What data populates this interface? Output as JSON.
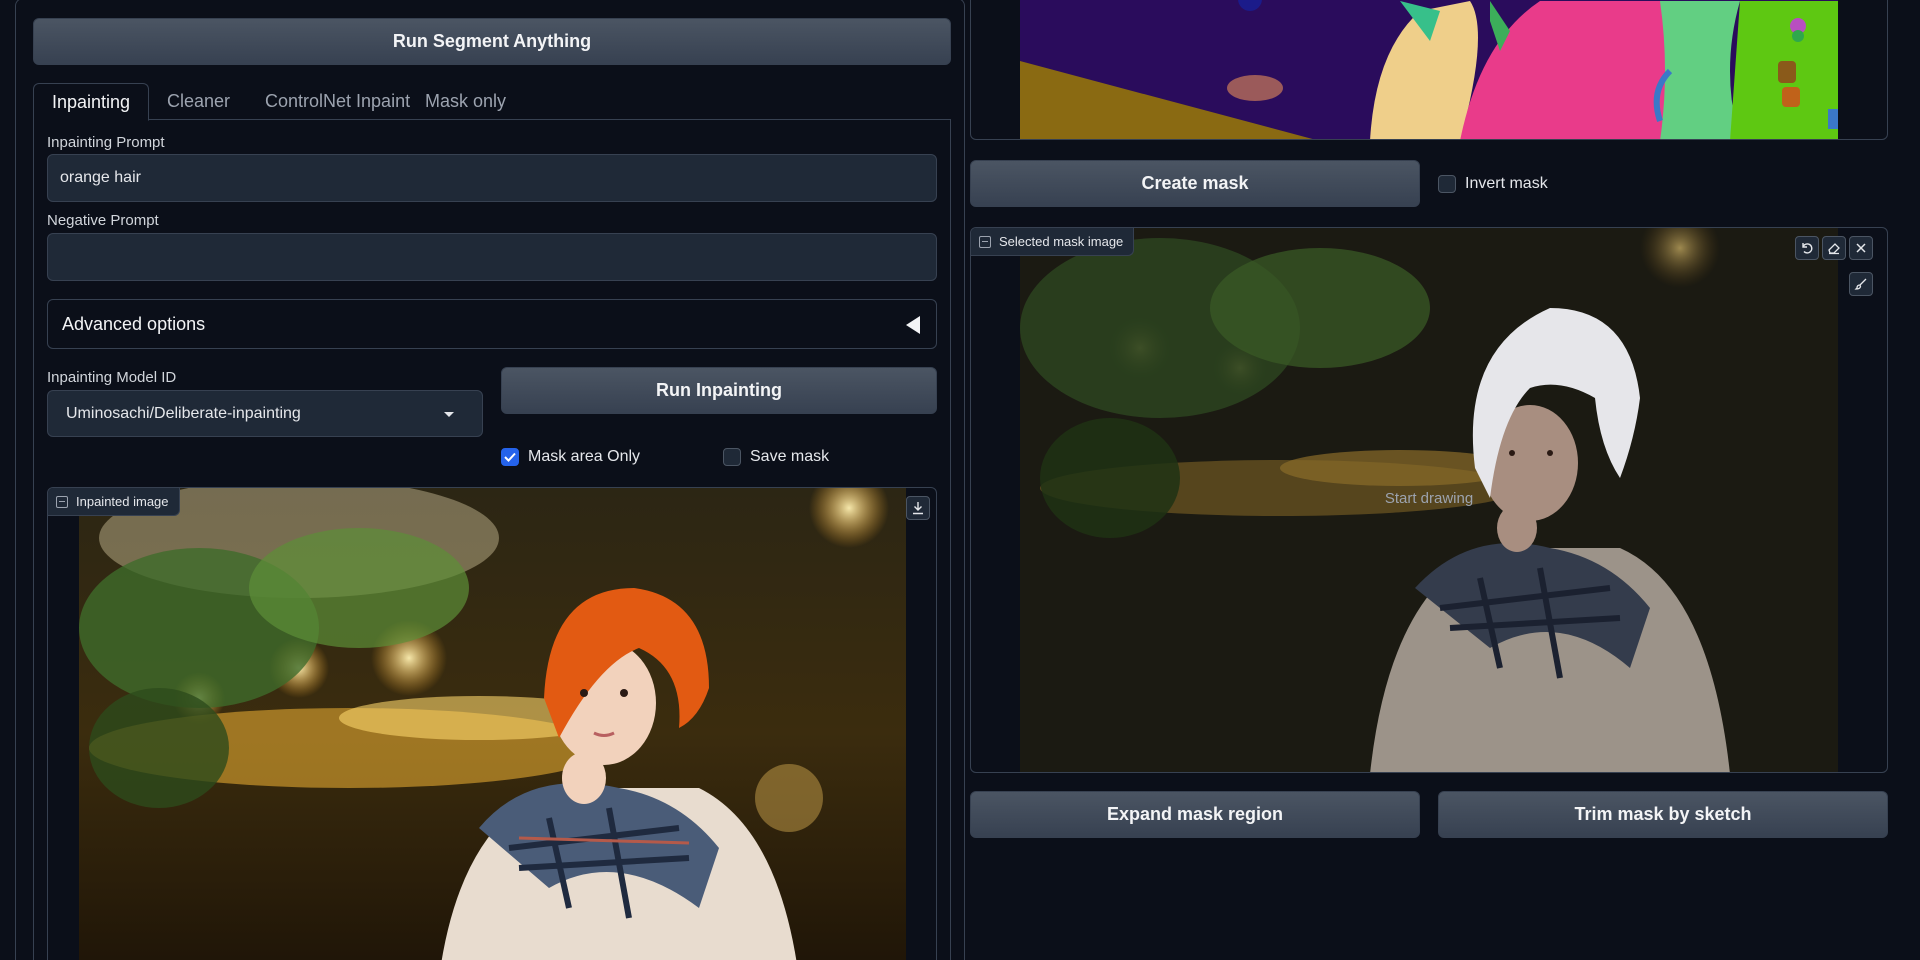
{
  "buttons": {
    "run_segment": "Run Segment Anything",
    "run_inpainting": "Run Inpainting",
    "create_mask": "Create mask",
    "expand_mask": "Expand mask region",
    "trim_mask": "Trim mask by sketch"
  },
  "tabs": [
    {
      "label": "Inpainting",
      "active": true
    },
    {
      "label": "Cleaner",
      "active": false
    },
    {
      "label": "ControlNet Inpaint",
      "active": false
    },
    {
      "label": "Mask only",
      "active": false
    }
  ],
  "inpainting": {
    "prompt_label": "Inpainting Prompt",
    "prompt_value": "orange hair",
    "negative_label": "Negative Prompt",
    "negative_value": "",
    "advanced_label": "Advanced options",
    "model_label": "Inpainting Model ID",
    "model_value": "Uminosachi/Deliberate-inpainting",
    "mask_area_only_label": "Mask area Only",
    "mask_area_only_checked": true,
    "save_mask_label": "Save mask",
    "save_mask_checked": false,
    "output_label": "Inpainted image"
  },
  "mask": {
    "invert_label": "Invert mask",
    "invert_checked": false,
    "selected_label": "Selected mask image",
    "placeholder": "Start drawing"
  },
  "colors": {
    "background": "#0b0f19",
    "panel_border": "#374151",
    "button_top": "#4b5563",
    "button_bottom": "#374151",
    "checkbox_accent": "#2563eb",
    "hair_orange": "#e25a12"
  },
  "icons": {
    "image_tag": "image-icon",
    "download": "download-icon",
    "undo": "undo-icon",
    "eraser": "eraser-icon",
    "close": "close-icon",
    "brush": "brush-icon"
  }
}
